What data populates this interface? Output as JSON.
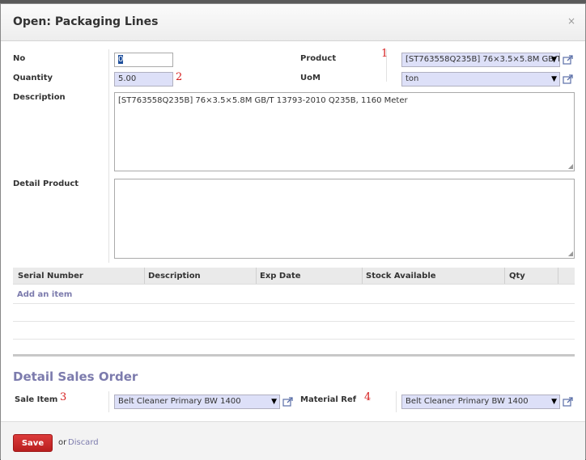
{
  "dialog": {
    "title": "Open: Packaging Lines",
    "close": "×"
  },
  "fields": {
    "no_label": "No",
    "no_value": "0",
    "quantity_label": "Quantity",
    "quantity_value": "5.00",
    "product_label": "Product",
    "product_value": "[ST763558Q235B] 76×3.5×5.8M GB/T",
    "uom_label": "UoM",
    "uom_value": "ton",
    "description_label": "Description",
    "description_value": "[ST763558Q235B] 76×3.5×5.8M GB/T 13793-2010 Q235B, 1160 Meter",
    "detail_product_label": "Detail Product",
    "detail_product_value": ""
  },
  "annotations": {
    "n1": "1",
    "n2": "2",
    "n3": "3",
    "n4": "4"
  },
  "table": {
    "columns": [
      "Serial Number",
      "Description",
      "Exp Date",
      "Stock Available",
      "Qty"
    ],
    "add_item": "Add an item"
  },
  "sales_order": {
    "heading": "Detail Sales Order",
    "sale_item_label": "Sale Item",
    "sale_item_value": "Belt Cleaner Primary BW 1400",
    "material_ref_label": "Material Ref",
    "material_ref_value": "Belt Cleaner Primary BW 1400"
  },
  "footer": {
    "save": "Save",
    "or": "or",
    "discard": "Discard"
  },
  "colors": {
    "accent": "#7c7bad",
    "annotation": "#d62020",
    "save_button": "#c62828",
    "required_field": "#dde0f8"
  },
  "icons": {
    "external_link": "external-link-icon",
    "dropdown": "chevron-down-icon",
    "resize": "resize-grip-icon"
  }
}
